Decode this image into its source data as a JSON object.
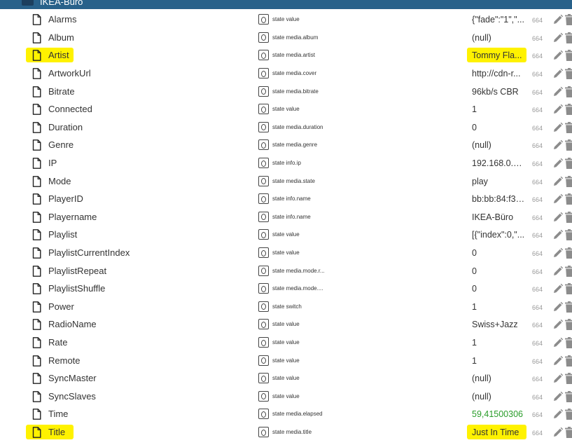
{
  "header": {
    "title": "IKEA-Büro",
    "icon": "folder-icon",
    "background": "#28618a"
  },
  "highlight_color": "#fff200",
  "value_colors": {
    "default": "#333333",
    "changed": "#2a9d2a"
  },
  "rows": [
    {
      "name": "Alarms",
      "role": "state value",
      "value": "{\"fade\":\"1\",\"...",
      "acl": "664",
      "icon": "file-icon"
    },
    {
      "name": "Album",
      "role": "state media.album",
      "value": "(null)",
      "acl": "664",
      "icon": "file-icon"
    },
    {
      "name": "Artist",
      "role": "state media.artist",
      "value": "Tommy Fla...",
      "acl": "664",
      "icon": "file-icon",
      "highlighted": true
    },
    {
      "name": "ArtworkUrl",
      "role": "state media.cover",
      "value": "http://cdn-r...",
      "acl": "664",
      "icon": "file-icon"
    },
    {
      "name": "Bitrate",
      "role": "state media.bitrate",
      "value": "96kb/s CBR",
      "acl": "664",
      "icon": "file-icon"
    },
    {
      "name": "Connected",
      "role": "state value",
      "value": "1",
      "acl": "664",
      "icon": "file-icon"
    },
    {
      "name": "Duration",
      "role": "state media.duration",
      "value": "0",
      "acl": "664",
      "icon": "file-icon"
    },
    {
      "name": "Genre",
      "role": "state media.genre",
      "value": "(null)",
      "acl": "664",
      "icon": "file-icon"
    },
    {
      "name": "IP",
      "role": "state info.ip",
      "value": "192.168.0.4...",
      "acl": "664",
      "icon": "file-icon"
    },
    {
      "name": "Mode",
      "role": "state media.state",
      "value": "play",
      "acl": "664",
      "icon": "file-icon"
    },
    {
      "name": "PlayerID",
      "role": "state info.name",
      "value": "bb:bb:84:f3:...",
      "acl": "664",
      "icon": "file-icon"
    },
    {
      "name": "Playername",
      "role": "state info.name",
      "value": "IKEA-Büro",
      "acl": "664",
      "icon": "file-icon"
    },
    {
      "name": "Playlist",
      "role": "state value",
      "value": "[{\"index\":0,\"...",
      "acl": "664",
      "icon": "file-icon"
    },
    {
      "name": "PlaylistCurrentIndex",
      "role": "state value",
      "value": "0",
      "acl": "664",
      "icon": "file-icon"
    },
    {
      "name": "PlaylistRepeat",
      "role": "state media.mode.r...",
      "value": "0",
      "acl": "664",
      "icon": "file-icon"
    },
    {
      "name": "PlaylistShuffle",
      "role": "state media.mode....",
      "value": "0",
      "acl": "664",
      "icon": "file-icon"
    },
    {
      "name": "Power",
      "role": "state switch",
      "value": "1",
      "acl": "664",
      "icon": "file-icon"
    },
    {
      "name": "RadioName",
      "role": "state value",
      "value": "Swiss+Jazz",
      "acl": "664",
      "icon": "file-icon"
    },
    {
      "name": "Rate",
      "role": "state value",
      "value": "1",
      "acl": "664",
      "icon": "file-icon"
    },
    {
      "name": "Remote",
      "role": "state value",
      "value": "1",
      "acl": "664",
      "icon": "file-icon"
    },
    {
      "name": "SyncMaster",
      "role": "state value",
      "value": "(null)",
      "acl": "664",
      "icon": "file-icon"
    },
    {
      "name": "SyncSlaves",
      "role": "state value",
      "value": "(null)",
      "acl": "664",
      "icon": "file-icon"
    },
    {
      "name": "Time",
      "role": "state media.elapsed",
      "value": "59,41500306",
      "acl": "664",
      "icon": "file-icon",
      "value_changed": true
    },
    {
      "name": "Title",
      "role": "state media.title",
      "value": "Just In Time",
      "acl": "664",
      "icon": "file-icon",
      "highlighted": true
    }
  ]
}
